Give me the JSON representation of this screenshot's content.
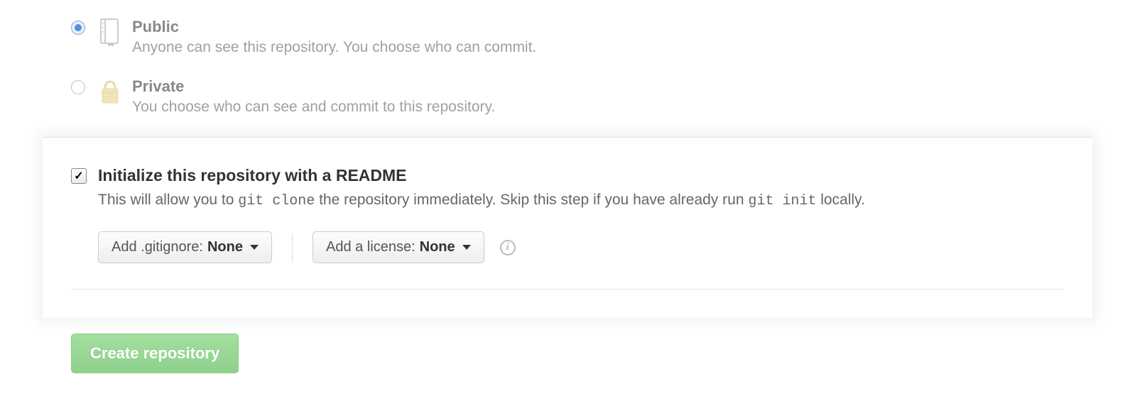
{
  "visibility": {
    "public": {
      "title": "Public",
      "desc": "Anyone can see this repository. You choose who can commit.",
      "selected": true
    },
    "private": {
      "title": "Private",
      "desc": "You choose who can see and commit to this repository.",
      "selected": false
    }
  },
  "init": {
    "checked": true,
    "heading": "Initialize this repository with a README",
    "desc_parts": {
      "a": "This will allow you to ",
      "code1": "git clone",
      "b": " the repository immediately. Skip this step if you have already run ",
      "code2": "git init",
      "c": " locally."
    }
  },
  "gitignore": {
    "label": "Add .gitignore: ",
    "value": "None"
  },
  "license": {
    "label": "Add a license: ",
    "value": "None"
  },
  "submit": {
    "label": "Create repository"
  }
}
